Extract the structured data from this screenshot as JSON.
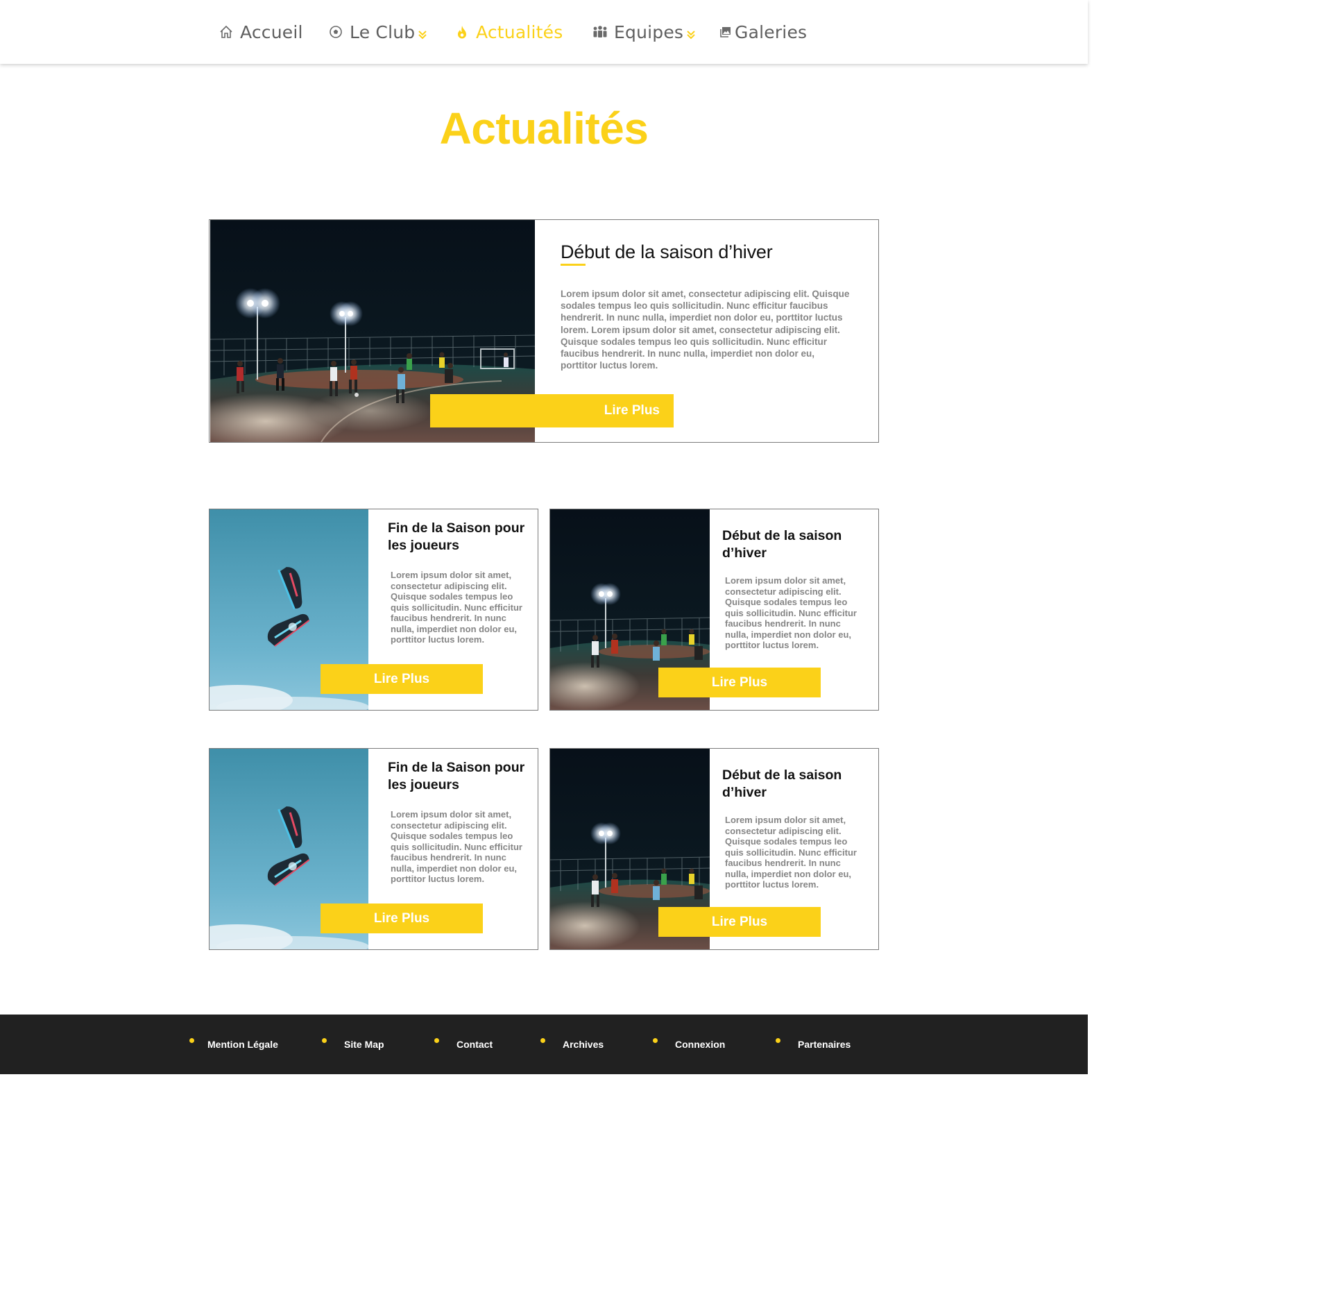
{
  "nav": {
    "items": [
      {
        "label": "Accueil",
        "icon": "home-icon"
      },
      {
        "label": "Le Club",
        "icon": "soccer-ball-icon",
        "has_dropdown": true
      },
      {
        "label": "Actualités",
        "icon": "flame-icon",
        "active": true
      },
      {
        "label": "Equipes",
        "icon": "team-icon",
        "has_dropdown": true
      },
      {
        "label": "Galeries",
        "icon": "gallery-icon"
      }
    ]
  },
  "page": {
    "title": "Actualités"
  },
  "featured": {
    "title": "Début de la saison d’hiver",
    "body": "Lorem ipsum dolor sit amet, consectetur adipiscing elit. Quisque sodales tempus leo quis sollicitudin. Nunc efficitur faucibus hendrerit. In nunc nulla, imperdiet non dolor eu, porttitor luctus lorem. Lorem ipsum dolor sit amet, consectetur adipiscing elit. Quisque sodales tempus leo quis sollicitudin. Nunc efficitur faucibus hendrerit. In nunc nulla, imperdiet non dolor eu, porttitor luctus lorem.",
    "button": "Lire Plus"
  },
  "cards": [
    {
      "title": "Fin de la Saison pour les joueurs",
      "body": "Lorem ipsum dolor sit amet, consectetur adipiscing elit. Quisque sodales tempus leo quis sollicitudin. Nunc efficitur faucibus hendrerit. In nunc nulla, imperdiet non dolor eu, porttitor luctus lorem.",
      "button": "Lire Plus"
    },
    {
      "title": "Début de la saison d’hiver",
      "body": "Lorem ipsum dolor sit amet, consectetur adipiscing elit. Quisque sodales tempus leo quis sollicitudin. Nunc efficitur faucibus hendrerit. In nunc nulla, imperdiet non dolor eu, porttitor luctus lorem.",
      "button": "Lire Plus"
    },
    {
      "title": "Fin de la Saison pour les joueurs",
      "body": "Lorem ipsum dolor sit amet, consectetur adipiscing elit. Quisque sodales tempus leo quis sollicitudin. Nunc efficitur faucibus hendrerit. In nunc nulla, imperdiet non dolor eu, porttitor luctus lorem.",
      "button": "Lire Plus"
    },
    {
      "title": "Début de la saison d’hiver",
      "body": "Lorem ipsum dolor sit amet, consectetur adipiscing elit. Quisque sodales tempus leo quis sollicitudin. Nunc efficitur faucibus hendrerit. In nunc nulla, imperdiet non dolor eu, porttitor luctus lorem.",
      "button": "Lire Plus"
    }
  ],
  "footer": {
    "links": [
      "Mention Légale",
      "Site Map",
      "Contact",
      "Archives",
      "Connexion",
      "Partenaires"
    ]
  },
  "colors": {
    "accent": "#fbd119",
    "nav_text": "#5f5f5f",
    "body_text": "#858585",
    "footer_bg": "#212121"
  }
}
